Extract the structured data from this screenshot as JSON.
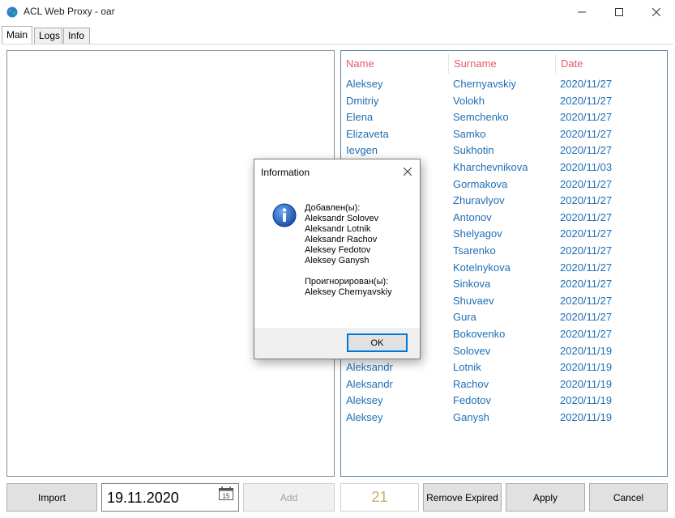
{
  "window": {
    "title": "ACL Web Proxy - oar",
    "icon": "globe-icon"
  },
  "tabs": [
    {
      "label": "Main"
    },
    {
      "label": "Logs"
    },
    {
      "label": "Info"
    }
  ],
  "list": {
    "headers": [
      "Name",
      "Surname",
      "Date"
    ],
    "rows": [
      [
        "Aleksey",
        "Chernyavskiy",
        "2020/11/27"
      ],
      [
        "Dmitriy",
        "Volokh",
        "2020/11/27"
      ],
      [
        "Elena",
        "Semchenko",
        "2020/11/27"
      ],
      [
        "Elizaveta",
        "Samko",
        "2020/11/27"
      ],
      [
        "Ievgen",
        "Sukhotin",
        "2020/11/27"
      ],
      [
        "",
        "Kharchevnikova",
        "2020/11/03"
      ],
      [
        "",
        "Gormakova",
        "2020/11/27"
      ],
      [
        "",
        "Zhuravlyov",
        "2020/11/27"
      ],
      [
        "",
        "Antonov",
        "2020/11/27"
      ],
      [
        "",
        "Shelyagov",
        "2020/11/27"
      ],
      [
        "",
        "Tsarenko",
        "2020/11/27"
      ],
      [
        "",
        "Kotelnykova",
        "2020/11/27"
      ],
      [
        "",
        "Sinkova",
        "2020/11/27"
      ],
      [
        "",
        "Shuvaev",
        "2020/11/27"
      ],
      [
        "",
        "Gura",
        "2020/11/27"
      ],
      [
        "",
        "Bokovenko",
        "2020/11/27"
      ],
      [
        "",
        "Solovev",
        "2020/11/19"
      ],
      [
        "Aleksandr",
        "Lotnik",
        "2020/11/19"
      ],
      [
        "Aleksandr",
        "Rachov",
        "2020/11/19"
      ],
      [
        "Aleksey",
        "Fedotov",
        "2020/11/19"
      ],
      [
        "Aleksey",
        "Ganysh",
        "2020/11/19"
      ]
    ]
  },
  "toolbar": {
    "import_label": "Import",
    "date_value": "19.11.2020",
    "calendar_day": "15",
    "add_label": "Add",
    "count": "21",
    "remove_expired_label": "Remove Expired",
    "apply_label": "Apply",
    "cancel_label": "Cancel"
  },
  "dialog": {
    "title": "Information",
    "lines": [
      "Добавлен(ы):",
      "Aleksandr Solovev",
      "Aleksandr Lotnik",
      "Aleksandr Rachov",
      "Aleksey Fedotov",
      "Aleksey Ganysh",
      "",
      "Проигнорирован(ы):",
      "Aleksey Chernyavskiy"
    ],
    "ok_label": "OK"
  }
}
